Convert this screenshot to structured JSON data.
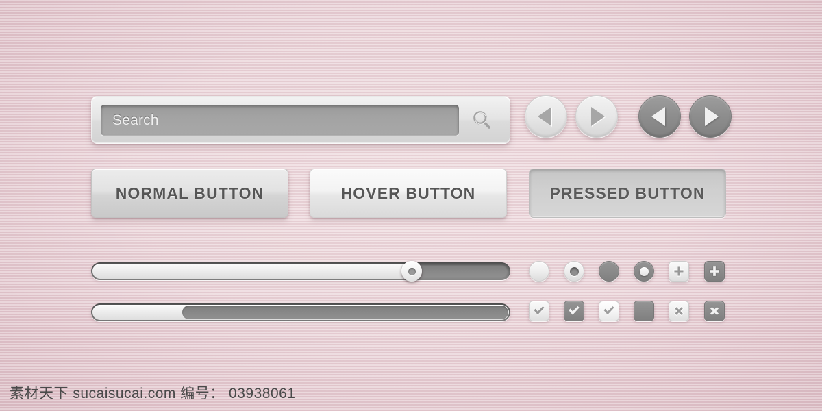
{
  "background": {
    "color": "#e9d2d7",
    "texture": "horizontal-stripes"
  },
  "palette": {
    "page_pink": "#e9d2d7",
    "light_control": "#ededed",
    "dark_control": "#8a8a8a",
    "track_dark": "#7e7e7e",
    "label_text": "#565656",
    "placeholder_text": "#f0f0f0"
  },
  "search": {
    "placeholder": "Search",
    "value": "",
    "icon": "search-icon"
  },
  "nav_buttons": [
    {
      "name": "prev-light",
      "icon": "triangle-left-icon",
      "state": "normal"
    },
    {
      "name": "next-light",
      "icon": "triangle-right-icon",
      "state": "normal"
    },
    {
      "name": "prev-dark",
      "icon": "triangle-left-icon",
      "state": "pressed"
    },
    {
      "name": "next-dark",
      "icon": "triangle-right-icon",
      "state": "pressed"
    }
  ],
  "buttons": [
    {
      "label": "NORMAL BUTTON",
      "state": "normal"
    },
    {
      "label": "HOVER BUTTON",
      "state": "hover"
    },
    {
      "label": "PRESSED BUTTON",
      "state": "pressed"
    }
  ],
  "sliders": [
    {
      "name": "slider-with-knob",
      "value_percent": 78,
      "filled_side": "left",
      "has_knob": true
    },
    {
      "name": "progress-bar",
      "value_percent": 22,
      "filled_side": "left",
      "has_knob": false
    }
  ],
  "radio_row": [
    {
      "name": "radio-unchecked-light",
      "style": "light",
      "mark": "none"
    },
    {
      "name": "radio-checked-light",
      "style": "light",
      "mark": "dot-dark"
    },
    {
      "name": "radio-unchecked-dark",
      "style": "dark",
      "mark": "none"
    },
    {
      "name": "radio-checked-dark",
      "style": "dark",
      "mark": "dot-light"
    },
    {
      "name": "plus-button-light",
      "style": "light",
      "mark": "plus-icon"
    },
    {
      "name": "plus-button-dark",
      "style": "dark",
      "mark": "plus-icon"
    }
  ],
  "checkbox_row": [
    {
      "name": "checkbox-checked-light",
      "style": "light",
      "mark": "check-icon"
    },
    {
      "name": "checkbox-checked-dark",
      "style": "dark",
      "mark": "check-icon"
    },
    {
      "name": "checkbox-checked-hover",
      "style": "light",
      "mark": "check-icon"
    },
    {
      "name": "checkbox-filled-dark",
      "style": "dark",
      "mark": "none"
    },
    {
      "name": "close-button-light",
      "style": "light",
      "mark": "cross-icon"
    },
    {
      "name": "close-button-dark",
      "style": "dark",
      "mark": "cross-icon"
    }
  ],
  "watermark": {
    "text": "素材天下 sucaisucai.com  编号： 03938061"
  }
}
